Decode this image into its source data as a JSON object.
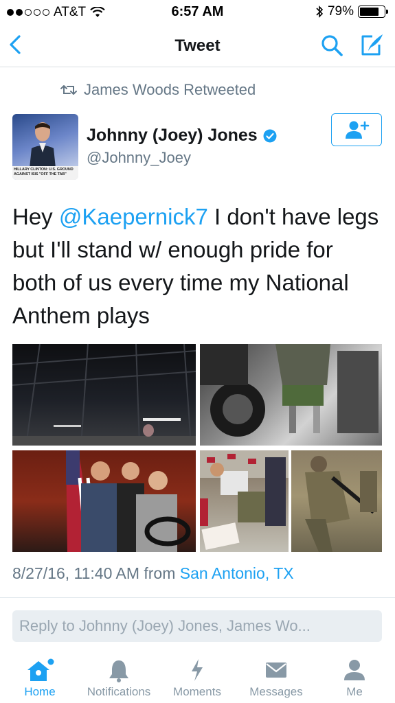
{
  "status_bar": {
    "carrier": "AT&T",
    "time": "6:57 AM",
    "battery": "79%",
    "battery_level": 0.79,
    "signal_bars_filled": 2,
    "signal_bars_total": 5
  },
  "nav": {
    "title": "Tweet",
    "icons": [
      "back-chevron-icon",
      "search-icon",
      "compose-icon"
    ]
  },
  "retweet": {
    "text": "James Woods Retweeted",
    "icon": "retweet-icon"
  },
  "author": {
    "name": "Johnny (Joey) Jones",
    "handle": "@Johnny_Joey",
    "verified": true,
    "avatar_caption": "HILLARY CLINTON: U.S. GROUND AGAINST ISIS \"OFF THE TAB\""
  },
  "tweet": {
    "prefix": "Hey ",
    "mention": "@Kaepernick7",
    "suffix": " I don't have legs but I'll stand w/ enough pride for both of us every time my National Anthem plays"
  },
  "media_count": 5,
  "meta": {
    "timestamp": "8/27/16, 11:40 AM from ",
    "location": "San Antonio, TX"
  },
  "reply": {
    "placeholder": "Reply to Johnny (Joey) Jones, James Wo..."
  },
  "tabs": [
    {
      "label": "Home",
      "icon": "home-icon",
      "active": true
    },
    {
      "label": "Notifications",
      "icon": "bell-icon",
      "active": false
    },
    {
      "label": "Moments",
      "icon": "lightning-icon",
      "active": false
    },
    {
      "label": "Messages",
      "icon": "envelope-icon",
      "active": false
    },
    {
      "label": "Me",
      "icon": "person-icon",
      "active": false
    }
  ],
  "colors": {
    "accent": "#1da1f2",
    "text": "#14171a",
    "secondary": "#657786",
    "tab_inactive": "#8899a6"
  }
}
